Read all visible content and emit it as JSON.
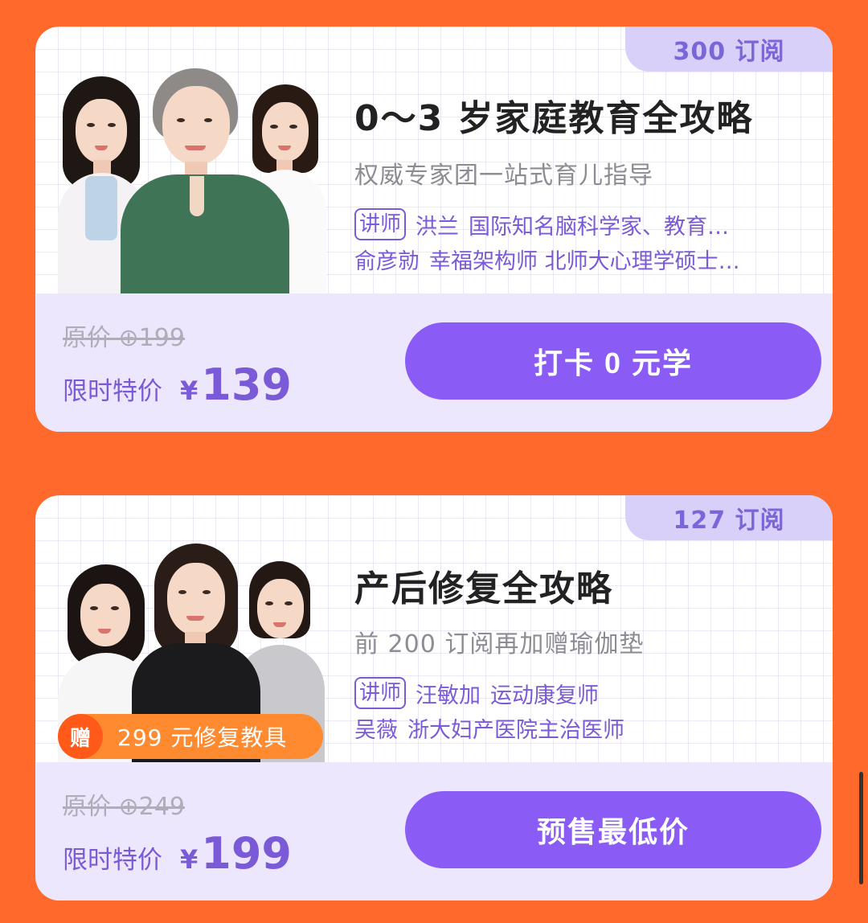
{
  "colors": {
    "background": "#FF6A2C",
    "accent": "#8A5CF5",
    "lecturer_text": "#7A5AD6",
    "badge_bg": "#D9D0FA",
    "price_panel_bg": "#EDE7FD"
  },
  "courses": [
    {
      "subscriptions": "300 订阅",
      "title": "0～3 岁家庭教育全攻略",
      "subtitle": "权威专家团一站式育儿指导",
      "lecturer_tag": "讲师",
      "lecturers": [
        {
          "name": "洪兰",
          "desc": "国际知名脑科学家、教育…"
        },
        {
          "name": "俞彦勍",
          "desc": "幸福架构师 北师大心理学硕士…"
        }
      ],
      "original_price": "原价 ⊕199",
      "sale_label": "限时特价",
      "currency": "¥",
      "sale_price": "139",
      "cta": "打卡 0 元学"
    },
    {
      "subscriptions": "127 订阅",
      "title": "产后修复全攻略",
      "subtitle": "前 200 订阅再加赠瑜伽垫",
      "lecturer_tag": "讲师",
      "lecturers": [
        {
          "name": "汪敏加",
          "desc": "运动康复师"
        },
        {
          "name": "吴薇",
          "desc": "浙大妇产医院主治医师"
        }
      ],
      "gift_icon": "赠",
      "gift_text": "299 元修复教具",
      "original_price": "原价 ⊕249",
      "sale_label": "限时特价",
      "currency": "¥",
      "sale_price": "199",
      "cta": "预售最低价"
    }
  ]
}
